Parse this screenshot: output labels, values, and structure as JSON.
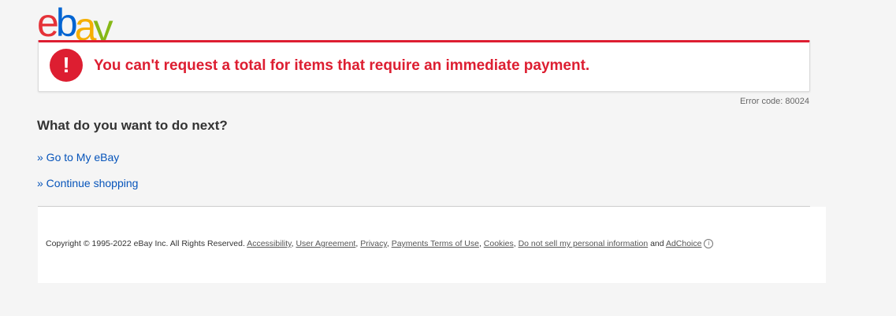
{
  "logo": {
    "letters": [
      "e",
      "b",
      "a",
      "y"
    ],
    "colors": [
      "#e53238",
      "#0064d2",
      "#f5af02",
      "#86b817"
    ]
  },
  "error": {
    "icon": "!",
    "message": "You can't request a total for items that require an immediate payment.",
    "code": "Error code: 80024",
    "accent": "#dd1e31"
  },
  "next": {
    "heading": "What do you want to do next?",
    "links": [
      {
        "label": "» Go to My eBay"
      },
      {
        "label": "» Continue shopping"
      }
    ],
    "link_color": "#0654ba"
  },
  "footer": {
    "copyright": "Copyright © 1995-2022 eBay Inc. All Rights Reserved.",
    "links": [
      "Accessibility",
      "User Agreement",
      "Privacy",
      "Payments Terms of Use",
      "Cookies",
      "Do not sell my personal information"
    ],
    "and_text": "and",
    "adchoice": "AdChoice",
    "info_icon": "i"
  }
}
